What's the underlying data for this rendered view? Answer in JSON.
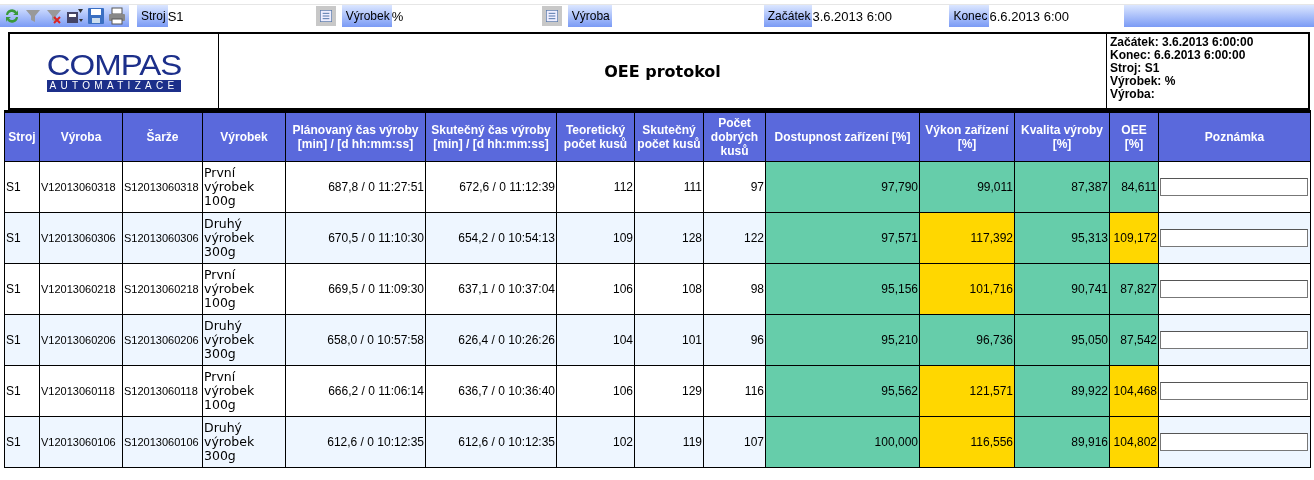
{
  "toolbar": {
    "filters": [
      {
        "label": "Stroj",
        "value": "S1",
        "picker": false
      },
      {
        "label": "Výrobek",
        "value": "%",
        "picker": true
      },
      {
        "label": "Výroba",
        "picker": true
      },
      {
        "label": "Začátek",
        "value": "3.6.2013 6:00",
        "picker": false
      },
      {
        "label": "Konec",
        "value": "6.6.2013 6:00",
        "picker": false
      }
    ]
  },
  "header": {
    "logo": {
      "name": "COMPAS",
      "tagline": "AUTOMATIZACE"
    },
    "title": "OEE protokol",
    "info": [
      "Začátek: 3.6.2013 6:00:00",
      "Konec: 6.6.2013 6:00:00",
      "Stroj: S1",
      "Výrobek: %",
      "Výroba:"
    ]
  },
  "table": {
    "columns": [
      "Stroj",
      "Výroba",
      "Šarže",
      "Výrobek",
      "Plánovaný čas výroby [min] / [d hh:mm:ss]",
      "Skutečný čas výroby [min] / [d hh:mm:ss]",
      "Teoretický počet kusů",
      "Skutečný počet kusů",
      "Počet dobrých kusů",
      "Dostupnost zařízení [%]",
      "Výkon zařízení [%]",
      "Kvalita výroby [%]",
      "OEE [%]",
      "Poznámka"
    ],
    "rows": [
      {
        "cells": [
          "S1",
          "V12013060318",
          "S12013060318",
          "První výrobek 100g",
          "687,8 / 0 11:27:51",
          "672,6 / 0 11:12:39",
          "112",
          "111",
          "97"
        ],
        "metrics": [
          {
            "value": "97,790",
            "color": "#66cdaa"
          },
          {
            "value": "99,011",
            "color": "#66cdaa"
          },
          {
            "value": "87,387",
            "color": "#66cdaa"
          },
          {
            "value": "84,611",
            "color": "#66cdaa"
          }
        ]
      },
      {
        "cells": [
          "S1",
          "V12013060306",
          "S12013060306",
          "Druhý výrobek 300g",
          "670,5 / 0 11:10:30",
          "654,2 / 0 10:54:13",
          "109",
          "128",
          "122"
        ],
        "metrics": [
          {
            "value": "97,571",
            "color": "#66cdaa"
          },
          {
            "value": "117,392",
            "color": "#ffd700"
          },
          {
            "value": "95,313",
            "color": "#66cdaa"
          },
          {
            "value": "109,172",
            "color": "#ffd700"
          }
        ]
      },
      {
        "cells": [
          "S1",
          "V12013060218",
          "S12013060218",
          "První výrobek 100g",
          "669,5 / 0 11:09:30",
          "637,1 / 0 10:37:04",
          "106",
          "108",
          "98"
        ],
        "metrics": [
          {
            "value": "95,156",
            "color": "#66cdaa"
          },
          {
            "value": "101,716",
            "color": "#ffd700"
          },
          {
            "value": "90,741",
            "color": "#66cdaa"
          },
          {
            "value": "87,827",
            "color": "#66cdaa"
          }
        ]
      },
      {
        "cells": [
          "S1",
          "V12013060206",
          "S12013060206",
          "Druhý výrobek 300g",
          "658,0 / 0 10:57:58",
          "626,4 / 0 10:26:26",
          "104",
          "101",
          "96"
        ],
        "metrics": [
          {
            "value": "95,210",
            "color": "#66cdaa"
          },
          {
            "value": "96,736",
            "color": "#66cdaa"
          },
          {
            "value": "95,050",
            "color": "#66cdaa"
          },
          {
            "value": "87,542",
            "color": "#66cdaa"
          }
        ]
      },
      {
        "cells": [
          "S1",
          "V12013060118",
          "S12013060118",
          "První výrobek 100g",
          "666,2 / 0 11:06:14",
          "636,7 / 0 10:36:40",
          "106",
          "129",
          "116"
        ],
        "metrics": [
          {
            "value": "95,562",
            "color": "#66cdaa"
          },
          {
            "value": "121,571",
            "color": "#ffd700"
          },
          {
            "value": "89,922",
            "color": "#66cdaa"
          },
          {
            "value": "104,468",
            "color": "#ffd700"
          }
        ]
      },
      {
        "cells": [
          "S1",
          "V12013060106",
          "S12013060106",
          "Druhý výrobek 300g",
          "612,6 / 0 10:12:35",
          "612,6 / 0 10:12:35",
          "102",
          "119",
          "107"
        ],
        "metrics": [
          {
            "value": "100,000",
            "color": "#66cdaa"
          },
          {
            "value": "116,556",
            "color": "#ffd700"
          },
          {
            "value": "89,916",
            "color": "#66cdaa"
          },
          {
            "value": "104,802",
            "color": "#ffd700"
          }
        ]
      }
    ]
  }
}
